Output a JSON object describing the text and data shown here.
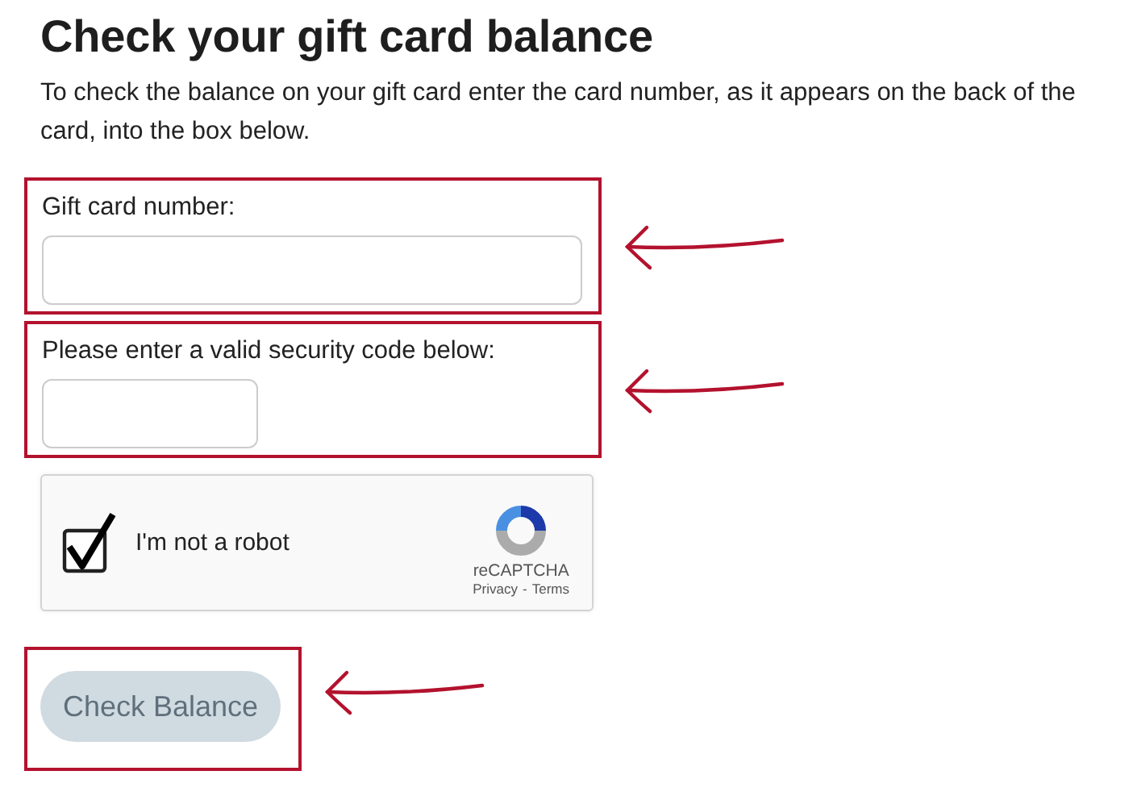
{
  "title": "Check your gift card balance",
  "intro": "To check the balance on your gift card enter the card number, as it appears on the back of the card, into the box below.",
  "fields": [
    {
      "label": "Gift card number:",
      "kind": "wide",
      "highlighted": true
    },
    {
      "label": "Please enter a valid security code below:",
      "kind": "short",
      "highlighted": true
    }
  ],
  "captcha": {
    "label": "I'm not a robot",
    "checked": true,
    "brand": "reCAPTCHA",
    "links": [
      "Privacy",
      "Terms"
    ],
    "separator": "-"
  },
  "button": {
    "label": "Check Balance",
    "disabled": true,
    "highlighted": true
  }
}
